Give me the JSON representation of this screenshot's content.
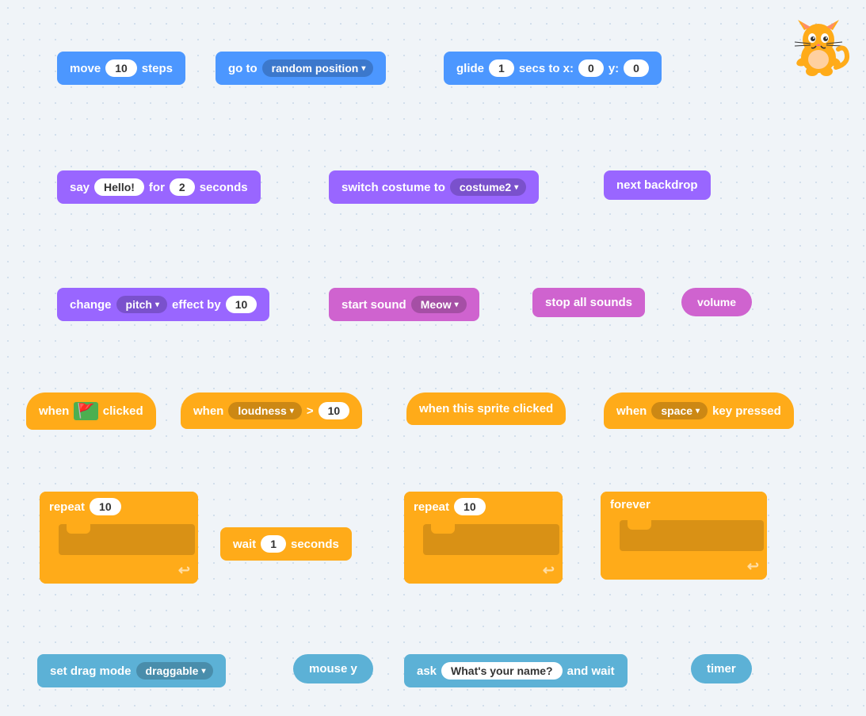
{
  "blocks": {
    "row1": {
      "move": {
        "label": "move",
        "value": "10",
        "suffix": "steps"
      },
      "goto": {
        "label": "go to",
        "dropdown": "random position"
      },
      "glide": {
        "label": "glide",
        "value": "1",
        "mid": "secs to x:",
        "x": "0",
        "y_label": "y:",
        "y": "0"
      }
    },
    "row2": {
      "say": {
        "label": "say",
        "value": "Hello!",
        "mid": "for",
        "num": "2",
        "suffix": "seconds"
      },
      "costume": {
        "label": "switch costume to",
        "dropdown": "costume2"
      },
      "backdrop": {
        "label": "next backdrop"
      }
    },
    "row3": {
      "change": {
        "label": "change",
        "dropdown": "pitch",
        "mid": "effect by",
        "value": "10"
      },
      "sound": {
        "label": "start sound",
        "dropdown": "Meow"
      },
      "stopSounds": {
        "label": "stop all sounds"
      },
      "volume": {
        "label": "volume"
      }
    },
    "row4": {
      "flagClicked": {
        "label_pre": "when",
        "flag": "🏁",
        "label_post": "clicked"
      },
      "loudness": {
        "label": "when",
        "dropdown": "loudness",
        "op": ">",
        "value": "10"
      },
      "spriteClicked": {
        "label": "when this sprite clicked"
      },
      "keyPressed": {
        "label": "when",
        "dropdown": "space",
        "suffix": "key pressed"
      }
    },
    "row5": {
      "repeat1": {
        "label": "repeat",
        "value": "10"
      },
      "wait": {
        "label": "wait",
        "value": "1",
        "suffix": "seconds"
      },
      "repeat2": {
        "label": "repeat",
        "value": "10"
      },
      "forever": {
        "label": "forever"
      }
    },
    "row6": {
      "dragMode": {
        "label": "set drag mode",
        "dropdown": "draggable"
      },
      "mouseY": {
        "label": "mouse y"
      },
      "ask": {
        "label": "ask",
        "value": "What's your name?",
        "suffix": "and wait"
      },
      "timer": {
        "label": "timer"
      }
    }
  }
}
